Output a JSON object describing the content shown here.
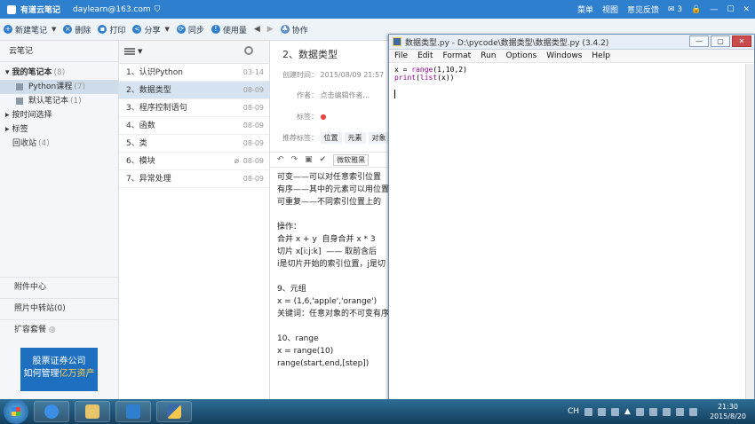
{
  "titlebar": {
    "app_name": "有道云笔记",
    "account": "daylearn@163.com",
    "menu": [
      "菜单",
      "视图",
      "意见反馈"
    ],
    "mail_count": "3"
  },
  "toolbar": {
    "new_note": "新建笔记",
    "delete": "删除",
    "print": "打印",
    "share": "分享",
    "sync": "同步",
    "usage": "使用量",
    "collab": "协作"
  },
  "sidebar": {
    "header": "云笔记",
    "my_notebooks": "我的笔记本",
    "my_notebooks_count": "(8)",
    "python_course": "Python课程",
    "python_course_count": "(7)",
    "default_notebook": "默认笔记本",
    "default_notebook_count": "(1)",
    "by_time": "按时间选择",
    "tags": "标签",
    "recycle": "回收站",
    "recycle_count": "(4)",
    "attachments": "附件中心",
    "photo_transfer": "照片中转站(0)",
    "expand": "扩容套餐",
    "ad_line1": "股票证券公司",
    "ad_line2_pre": "如何管理",
    "ad_line2_hl": "亿万资产"
  },
  "notes_list": [
    {
      "title": "1、认识Python",
      "date": "03-14"
    },
    {
      "title": "2、数据类型",
      "date": "08-09"
    },
    {
      "title": "3、程序控制语句",
      "date": "08-09"
    },
    {
      "title": "4、函数",
      "date": "08-09"
    },
    {
      "title": "5、类",
      "date": "08-09"
    },
    {
      "title": "6、模块",
      "date": "08-09"
    },
    {
      "title": "7、异常处理",
      "date": "08-09"
    }
  ],
  "note": {
    "title": "2、数据类型",
    "created_label": "创建时间：",
    "created_value": "2015/08/09 21:57",
    "author_label": "作者：",
    "author_value": "点击编辑作者...",
    "tags_label": "标签：",
    "rec_tags_label": "推荐标签：",
    "rec_tags": [
      "位置",
      "元素",
      "对象"
    ],
    "font": "微软雅黑",
    "body": [
      "可变——可以对任意索引位置",
      "有序——其中的元素可以用位置",
      "可重复——不同索引位置上的",
      "",
      "操作：",
      "合并 x + y  自身合并 x * 3",
      "切片 x[i:j:k]  —— 取前含后",
      "i是切片开始的索引位置，j是切",
      "",
      "9、元组",
      "x = (1,6,'apple','orange')",
      "关键词：任意对象的不可变有序",
      "",
      "10、range",
      "x = range(10)",
      "range(start,end,[step])"
    ]
  },
  "idle": {
    "title": "数据类型.py - D:\\pycode\\数据类型\\数据类型.py (3.4.2)",
    "menu": [
      "File",
      "Edit",
      "Format",
      "Run",
      "Options",
      "Windows",
      "Help"
    ],
    "code_line1_var": "x = ",
    "code_line1_kw": "range",
    "code_line1_args": "(1,10,2)",
    "code_line2_kw": "print",
    "code_line2_a": "(",
    "code_line2_kw2": "list",
    "code_line2_b": "(x))"
  },
  "taskbar": {
    "ime": "CH",
    "time": "21:30",
    "date": "2015/8/20"
  }
}
